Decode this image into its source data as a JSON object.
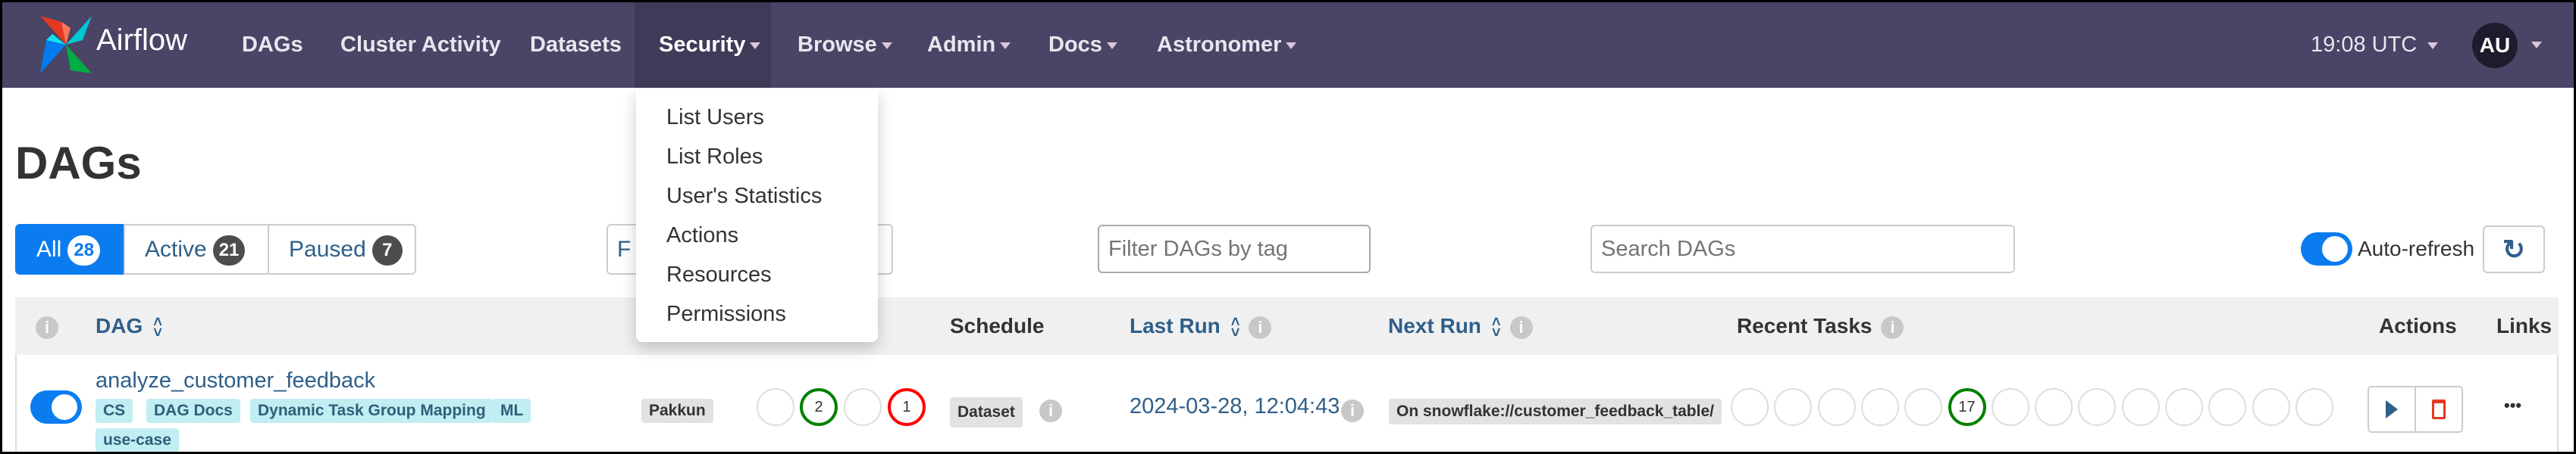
{
  "nav": {
    "brand": "Airflow",
    "items": [
      {
        "label": "DAGs"
      },
      {
        "label": "Cluster Activity"
      },
      {
        "label": "Datasets"
      },
      {
        "label": "Security"
      },
      {
        "label": "Browse"
      },
      {
        "label": "Admin"
      },
      {
        "label": "Docs"
      },
      {
        "label": "Astronomer"
      }
    ],
    "time": "19:08 UTC",
    "avatar": "AU",
    "color": "#4a4466"
  },
  "security_menu": [
    "List Users",
    "List Roles",
    "User's Statistics",
    "Actions",
    "Resources",
    "Permissions"
  ],
  "page_title": "DAGs",
  "filters": {
    "all": {
      "label": "All",
      "count": "28"
    },
    "active": {
      "label": "Active",
      "count": "21"
    },
    "paused": {
      "label": "Paused",
      "count": "7"
    },
    "hidden_button_initial": "F",
    "tag_placeholder": "Filter DAGs by tag",
    "search_placeholder": "Search DAGs",
    "auto_refresh": "Auto-refresh",
    "auto_refresh_on": true
  },
  "table": {
    "headers": {
      "dag": "DAG",
      "schedule": "Schedule",
      "last_run": "Last Run",
      "next_run": "Next Run",
      "recent_tasks": "Recent Tasks",
      "actions": "Actions",
      "links": "Links"
    },
    "rows": [
      {
        "dag_id": "analyze_customer_feedback",
        "active": true,
        "tags": [
          "CS",
          "DAG Docs",
          "Dynamic Task Group Mapping",
          "ML",
          "use-case"
        ],
        "owner": "Pakkun",
        "runs": [
          {
            "count": ""
          },
          {
            "count": "2",
            "state": "success"
          },
          {
            "count": ""
          },
          {
            "count": "1",
            "state": "failed"
          }
        ],
        "schedule": "Dataset",
        "last_run": "2024-03-28, 12:04:43",
        "next_run": "On snowflake://customer_feedback_table/",
        "recent_tasks": [
          "",
          "",
          "",
          "",
          "",
          "17",
          "",
          "",
          "",
          "",
          "",
          "",
          "",
          ""
        ],
        "links": "•••"
      }
    ]
  },
  "colors": {
    "success": "#008000",
    "failed": "#ff0000",
    "accent": "#0b7cf0",
    "link": "#2f5f8a"
  }
}
